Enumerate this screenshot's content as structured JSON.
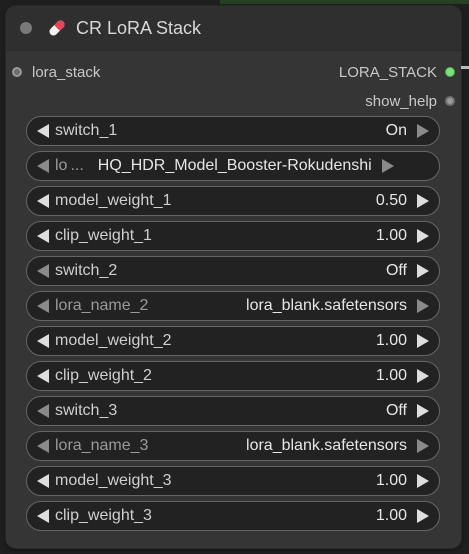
{
  "node": {
    "title": "CR LoRA Stack",
    "icon": "pill-icon"
  },
  "inputs": [
    {
      "label": "lora_stack"
    }
  ],
  "outputs": [
    {
      "label": "LORA_STACK",
      "color": "#7ce07c"
    },
    {
      "label": "show_help",
      "color": "#9a9a9a"
    }
  ],
  "widgets": [
    {
      "label": "switch_1",
      "value": "On"
    },
    {
      "label": "lo",
      "ellipsis": "...",
      "value": "HQ_HDR_Model_Booster-Rokudenshi"
    },
    {
      "label": "model_weight_1",
      "value": "0.50"
    },
    {
      "label": "clip_weight_1",
      "value": "1.00"
    },
    {
      "label": "switch_2",
      "value": "Off"
    },
    {
      "label": "lora_name_2",
      "value": "lora_blank.safetensors"
    },
    {
      "label": "model_weight_2",
      "value": "1.00"
    },
    {
      "label": "clip_weight_2",
      "value": "1.00"
    },
    {
      "label": "switch_3",
      "value": "Off"
    },
    {
      "label": "lora_name_3",
      "value": "lora_blank.safetensors"
    },
    {
      "label": "model_weight_3",
      "value": "1.00"
    },
    {
      "label": "clip_weight_3",
      "value": "1.00"
    }
  ],
  "colors": {
    "node_bg": "#353535",
    "widget_bg": "#222222",
    "link_green": "#7ce07c"
  }
}
